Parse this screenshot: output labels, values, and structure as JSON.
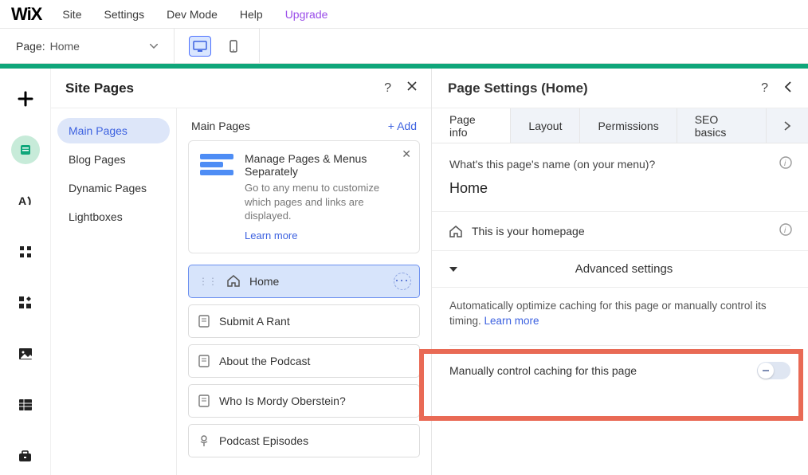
{
  "topbar": {
    "logo": "WiX",
    "menu": {
      "site": "Site",
      "settings": "Settings",
      "devmode": "Dev Mode",
      "help": "Help",
      "upgrade": "Upgrade"
    }
  },
  "pagebar": {
    "label": "Page:",
    "value": "Home"
  },
  "sitePages": {
    "title": "Site Pages",
    "nav": [
      {
        "label": "Main Pages"
      },
      {
        "label": "Blog Pages"
      },
      {
        "label": "Dynamic Pages"
      },
      {
        "label": "Lightboxes"
      }
    ],
    "listTitle": "Main Pages",
    "addLabel": "+ Add",
    "info": {
      "title": "Manage Pages & Menus Separately",
      "desc": "Go to any menu to customize which pages and links are displayed.",
      "learnMore": "Learn more"
    },
    "pages": [
      {
        "label": "Home",
        "icon": "home",
        "active": true
      },
      {
        "label": "Submit A Rant",
        "icon": "page"
      },
      {
        "label": "About the Podcast",
        "icon": "page"
      },
      {
        "label": "Who Is Mordy Oberstein?",
        "icon": "page"
      },
      {
        "label": "Podcast Episodes",
        "icon": "podcast"
      }
    ]
  },
  "settings": {
    "title": "Page Settings (Home)",
    "tabs": {
      "info": "Page info",
      "layout": "Layout",
      "perm": "Permissions",
      "seo": "SEO basics"
    },
    "nameLabel": "What's this page's name (on your menu)?",
    "nameValue": "Home",
    "homepageText": "This is your homepage",
    "advanced": "Advanced settings",
    "cacheDesc": "Automatically optimize caching for this page or manually control its timing. ",
    "cacheLearn": "Learn more",
    "toggleLabel": "Manually control caching for this page"
  }
}
